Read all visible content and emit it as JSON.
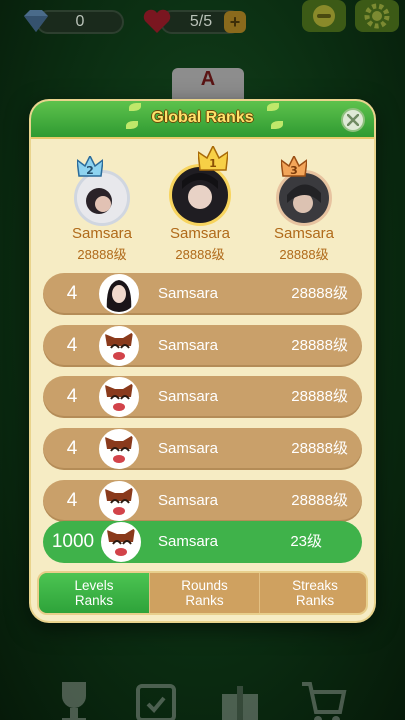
{
  "topbar": {
    "gems": "0",
    "lives": "5/5",
    "plus_label": "+"
  },
  "modal": {
    "title": "Global Ranks",
    "close_label": "×"
  },
  "podium": [
    {
      "crown": "2",
      "name": "Samsara",
      "level": "28888级"
    },
    {
      "crown": "1",
      "name": "Samsara",
      "level": "28888级"
    },
    {
      "crown": "3",
      "name": "Samsara",
      "level": "28888级"
    }
  ],
  "rows": [
    {
      "rank": "4",
      "name": "Samsara",
      "level": "28888级"
    },
    {
      "rank": "4",
      "name": "Samsara",
      "level": "28888级"
    },
    {
      "rank": "4",
      "name": "Samsara",
      "level": "28888级"
    },
    {
      "rank": "4",
      "name": "Samsara",
      "level": "28888级"
    },
    {
      "rank": "4",
      "name": "Samsara",
      "level": "28888级"
    }
  ],
  "me": {
    "rank": "1000",
    "name": "Samsara",
    "level": "23级"
  },
  "tabs": [
    {
      "line1": "Levels",
      "line2": "Ranks",
      "active": true
    },
    {
      "line1": "Rounds",
      "line2": "Ranks",
      "active": false
    },
    {
      "line1": "Streaks",
      "line2": "Ranks",
      "active": false
    }
  ],
  "colors": {
    "header_green": "#3aa83c",
    "panel_cream": "#f6ecc4",
    "row_tan": "#c9a06a",
    "me_green": "#3fb24a",
    "title_yellow": "#ffe36b"
  },
  "icons": {
    "gem": "diamond-icon",
    "lives": "heart-icon",
    "top_right_1": "smiley-icon",
    "top_right_2": "gear-icon",
    "close": "close-icon",
    "crown": "crown-icon",
    "bottom": [
      "trophy-icon",
      "calendar-icon",
      "gift-icon",
      "cart-icon"
    ]
  }
}
